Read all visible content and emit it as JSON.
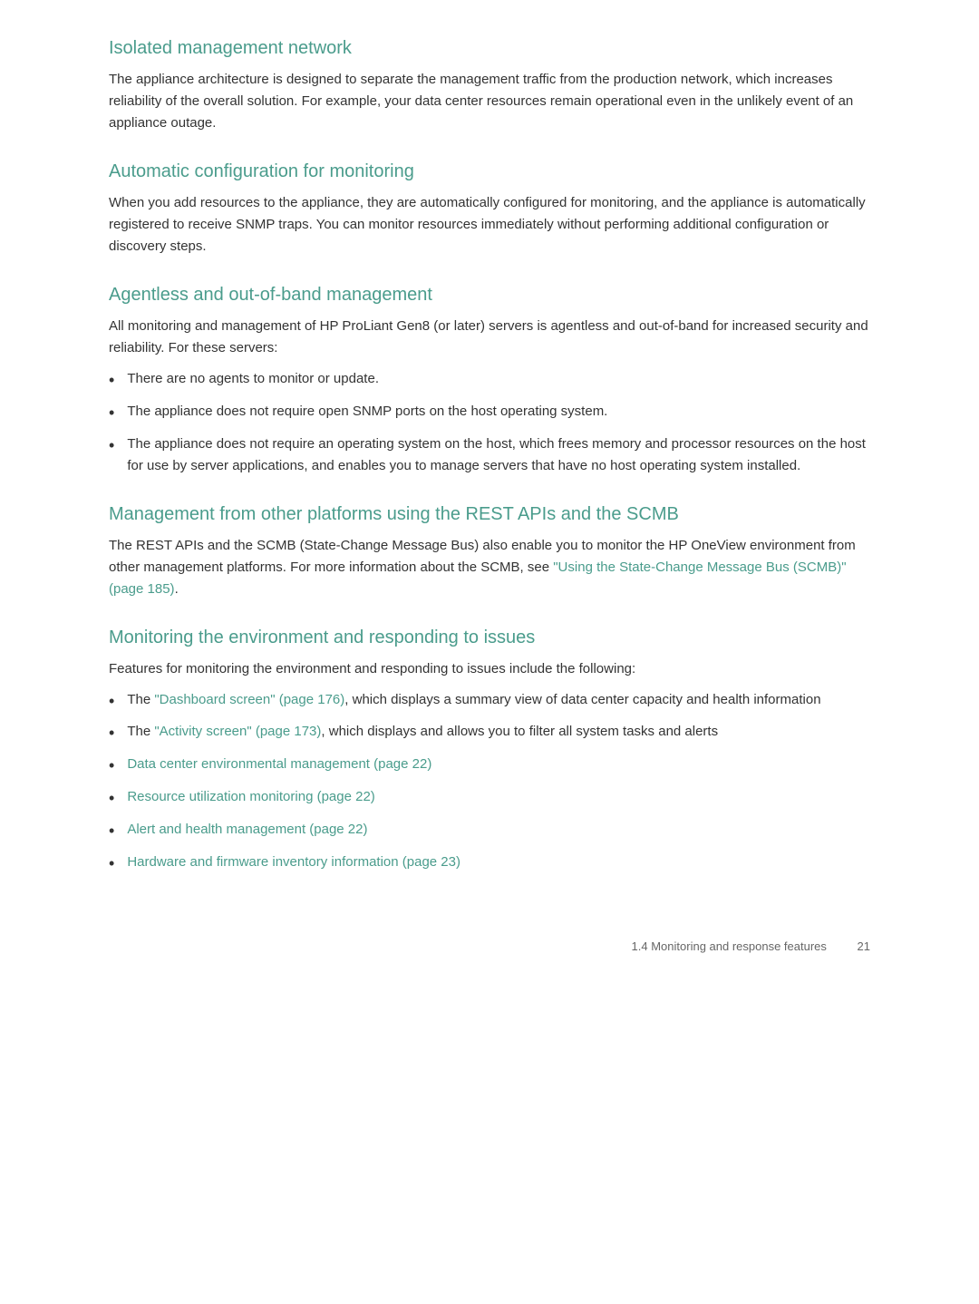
{
  "sections": [
    {
      "id": "isolated-management-network",
      "heading": "Isolated management network",
      "body": "The appliance architecture is designed to separate the management traffic from the production network, which increases reliability of the overall solution. For example, your data center resources remain operational even in the unlikely event of an appliance outage.",
      "bullets": []
    },
    {
      "id": "automatic-configuration",
      "heading": "Automatic configuration for monitoring",
      "body": "When you add resources to the appliance, they are automatically configured for monitoring, and the appliance is automatically registered to receive SNMP traps. You can monitor resources immediately without performing additional configuration or discovery steps.",
      "bullets": []
    },
    {
      "id": "agentless",
      "heading": "Agentless and out-of-band management",
      "body": "All monitoring and management of HP ProLiant Gen8 (or later) servers is agentless and out-of-band for increased security and reliability. For these servers:",
      "bullets": [
        {
          "text": "There are no agents to monitor or update.",
          "link": null
        },
        {
          "text": "The appliance does not require open SNMP ports on the host operating system.",
          "link": null
        },
        {
          "text": "The appliance does not require an operating system on the host, which frees memory and processor resources on the host for use by server applications, and enables you to manage servers that have no host operating system installed.",
          "link": null
        }
      ]
    },
    {
      "id": "management-rest-apis",
      "heading": "Management from other platforms using the REST APIs and the SCMB",
      "body_parts": [
        {
          "text": "The REST APIs and the SCMB (State-Change Message Bus) also enable you to monitor the HP OneView environment from other management platforms. For more information about the SCMB, see ",
          "link": null
        },
        {
          "text": "\"Using the State-Change Message Bus (SCMB)\" (page 185)",
          "link": true
        },
        {
          "text": ".",
          "link": null
        }
      ],
      "bullets": []
    },
    {
      "id": "monitoring-environment",
      "heading": "Monitoring the environment and responding to issues",
      "intro": "Features for monitoring the environment and responding to issues include the following:",
      "bullets": [
        {
          "prefix": "The ",
          "link_text": "\"Dashboard screen\" (page 176)",
          "suffix": ", which displays a summary view of data center capacity and health information",
          "is_link": true
        },
        {
          "prefix": "The ",
          "link_text": "\"Activity screen\" (page 173)",
          "suffix": ", which displays and allows you to filter all system tasks and alerts",
          "is_link": true
        },
        {
          "prefix": "",
          "link_text": "Data center environmental management (page 22)",
          "suffix": "",
          "is_link": true
        },
        {
          "prefix": "",
          "link_text": "Resource utilization monitoring (page 22)",
          "suffix": "",
          "is_link": true
        },
        {
          "prefix": "",
          "link_text": "Alert and health management (page 22)",
          "suffix": "",
          "is_link": true
        },
        {
          "prefix": "",
          "link_text": "Hardware and firmware inventory information (page 23)",
          "suffix": "",
          "is_link": true
        }
      ]
    }
  ],
  "footer": {
    "text": "1.4 Monitoring and response features",
    "page_number": "21"
  },
  "colors": {
    "heading": "#4a9c8c",
    "link": "#4a9c8c",
    "body": "#333333"
  }
}
